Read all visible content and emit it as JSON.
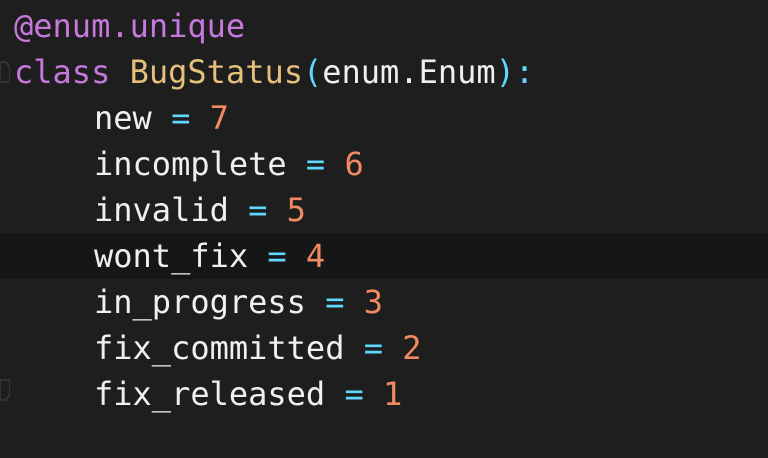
{
  "code": {
    "decorator": "@enum.unique",
    "class_keyword": "class",
    "class_name": "BugStatus",
    "open_paren": "(",
    "base_class": "enum.Enum",
    "close_paren": ")",
    "colon": ":",
    "members": [
      {
        "name": "new",
        "eq": "=",
        "value": "7"
      },
      {
        "name": "incomplete",
        "eq": "=",
        "value": "6"
      },
      {
        "name": "invalid",
        "eq": "=",
        "value": "5"
      },
      {
        "name": "wont_fix",
        "eq": "=",
        "value": "4"
      },
      {
        "name": "in_progress",
        "eq": "=",
        "value": "3"
      },
      {
        "name": "fix_committed",
        "eq": "=",
        "value": "2"
      },
      {
        "name": "fix_released",
        "eq": "=",
        "value": "1"
      }
    ]
  },
  "icons": {
    "fold_start": "fold-start-icon",
    "fold_end": "fold-end-icon"
  },
  "colors": {
    "background": "#1e1e1e",
    "current_line": "#161616",
    "keyword": "#c678dd",
    "class_name": "#e5c07b",
    "operator": "#5fd7ff",
    "number": "#f08a62",
    "identifier": "#f0f0f0"
  }
}
